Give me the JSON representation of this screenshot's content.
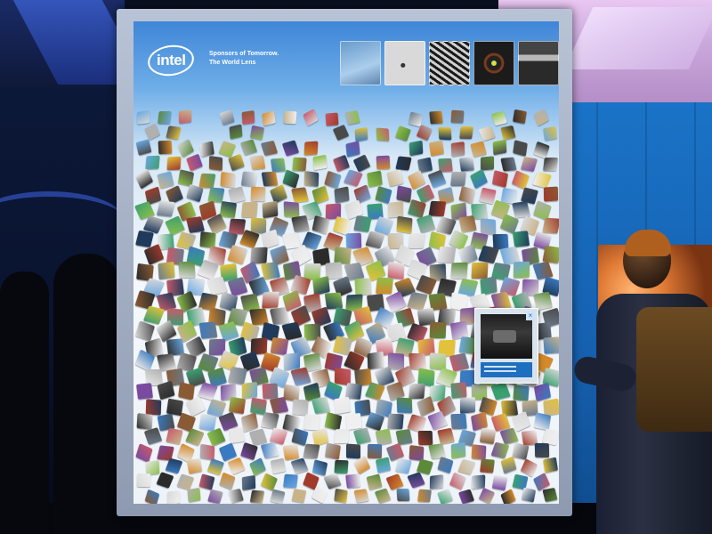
{
  "scene": {
    "type": "photograph",
    "subject": "backlit exhibition display with a mosaic of image tiles"
  },
  "display": {
    "logo_text": "intel",
    "tagline_line1": "Sponsors of Tomorrow.",
    "tagline_line2": "The World Lens",
    "thumbnails": [
      "thumbnail-1",
      "thumbnail-2",
      "thumbnail-3",
      "thumbnail-4",
      "thumbnail-5"
    ]
  },
  "colors": {
    "screen_top": "#3f86d8",
    "screen_body": "#f4f8fc",
    "booth_wall": "#1a73c7",
    "frame": "#b9c3d6"
  }
}
